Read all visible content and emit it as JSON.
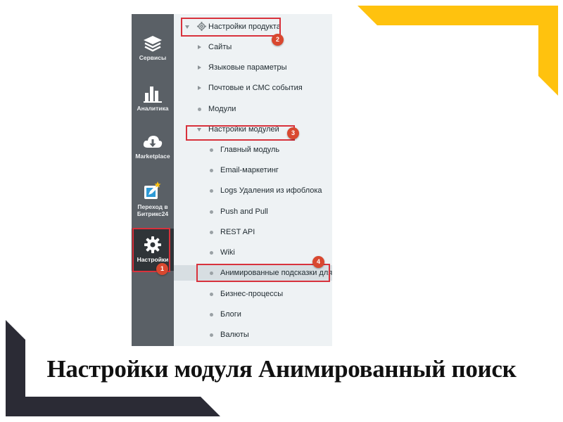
{
  "colors": {
    "sidebar_bg": "#5a6066",
    "sidebar_active_bg": "#2f3438",
    "tree_bg": "#eef2f4",
    "annotation_red": "#d8323c",
    "badge_orange": "#d9482f",
    "deco_yellow": "#ffc20e",
    "deco_dark": "#2b2b35"
  },
  "sidebar": {
    "items": [
      {
        "label": "Сервисы",
        "icon": "layers-icon",
        "active": false
      },
      {
        "label": "Аналитика",
        "icon": "bar-chart-icon",
        "active": false
      },
      {
        "label": "Marketplace",
        "icon": "cloud-download-icon",
        "active": false
      },
      {
        "label_line1": "Переход в",
        "label_line2": "Битрикс24",
        "icon": "external-edit-icon",
        "active": false
      },
      {
        "label": "Настройки",
        "icon": "gear-icon",
        "active": true
      }
    ]
  },
  "tree": {
    "items": [
      {
        "label": "Настройки продукта",
        "marker": "expanded",
        "level": 0
      },
      {
        "label": "Сайты",
        "marker": "collapsed",
        "level": 1
      },
      {
        "label": "Языковые параметры",
        "marker": "collapsed",
        "level": 1
      },
      {
        "label": "Почтовые и СМС события",
        "marker": "collapsed",
        "level": 1
      },
      {
        "label": "Модули",
        "marker": "dot",
        "level": 1
      },
      {
        "label": "Настройки модулей",
        "marker": "expanded",
        "level": 1
      },
      {
        "label": "Главный модуль",
        "marker": "dot",
        "level": 2
      },
      {
        "label": "Email-маркетинг",
        "marker": "dot",
        "level": 2
      },
      {
        "label": "Logs Удаления из ифоблока",
        "marker": "dot",
        "level": 2
      },
      {
        "label": "Push and Pull",
        "marker": "dot",
        "level": 2
      },
      {
        "label": "REST API",
        "marker": "dot",
        "level": 2
      },
      {
        "label": "Wiki",
        "marker": "dot",
        "level": 2
      },
      {
        "label": "Анимированные подсказки для",
        "marker": "dot",
        "level": 2,
        "highlighted": true
      },
      {
        "label": "Бизнес-процессы",
        "marker": "dot",
        "level": 2
      },
      {
        "label": "Блоги",
        "marker": "dot",
        "level": 2
      },
      {
        "label": "Валюты",
        "marker": "dot",
        "level": 2
      }
    ]
  },
  "annotations": [
    {
      "number": "1"
    },
    {
      "number": "2"
    },
    {
      "number": "3"
    },
    {
      "number": "4"
    }
  ],
  "caption": "Настройки модуля Анимированный поиск"
}
